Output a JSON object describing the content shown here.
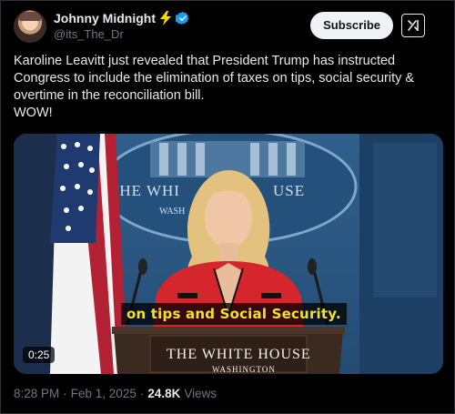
{
  "author": {
    "display_name": "Johnny Midnight",
    "handle": "@its_The_Dr",
    "badge_emoji": "lightning-bolt-icon",
    "verified_icon": "verified-badge-icon"
  },
  "actions": {
    "subscribe_label": "Subscribe",
    "grok_icon": "grok-icon"
  },
  "tweet": {
    "line1": "Karoline Leavitt just revealed that President Trump has instructed Congress to include the elimination of taxes on tips, social security & overtime in the reconciliation bill.",
    "line2": "WOW!"
  },
  "media": {
    "backdrop_text": "THE WHI   USE",
    "backdrop_sub": "WASH",
    "caption": "on tips and Social Security.",
    "podium_title": "THE WHITE HOUSE",
    "podium_sub": "WASHINGTON",
    "duration": "0:25"
  },
  "footer": {
    "time": "8:28 PM",
    "sep": "·",
    "date": "Feb 1, 2025",
    "sep2": "·",
    "views_count": "24.8K",
    "views_label": "Views"
  },
  "colors": {
    "background": "#000000",
    "text": "#e7e9ea",
    "muted": "#71767b",
    "verified": "#1d9bf0",
    "bolt": "#ffd400",
    "caption": "#f2e02a"
  }
}
